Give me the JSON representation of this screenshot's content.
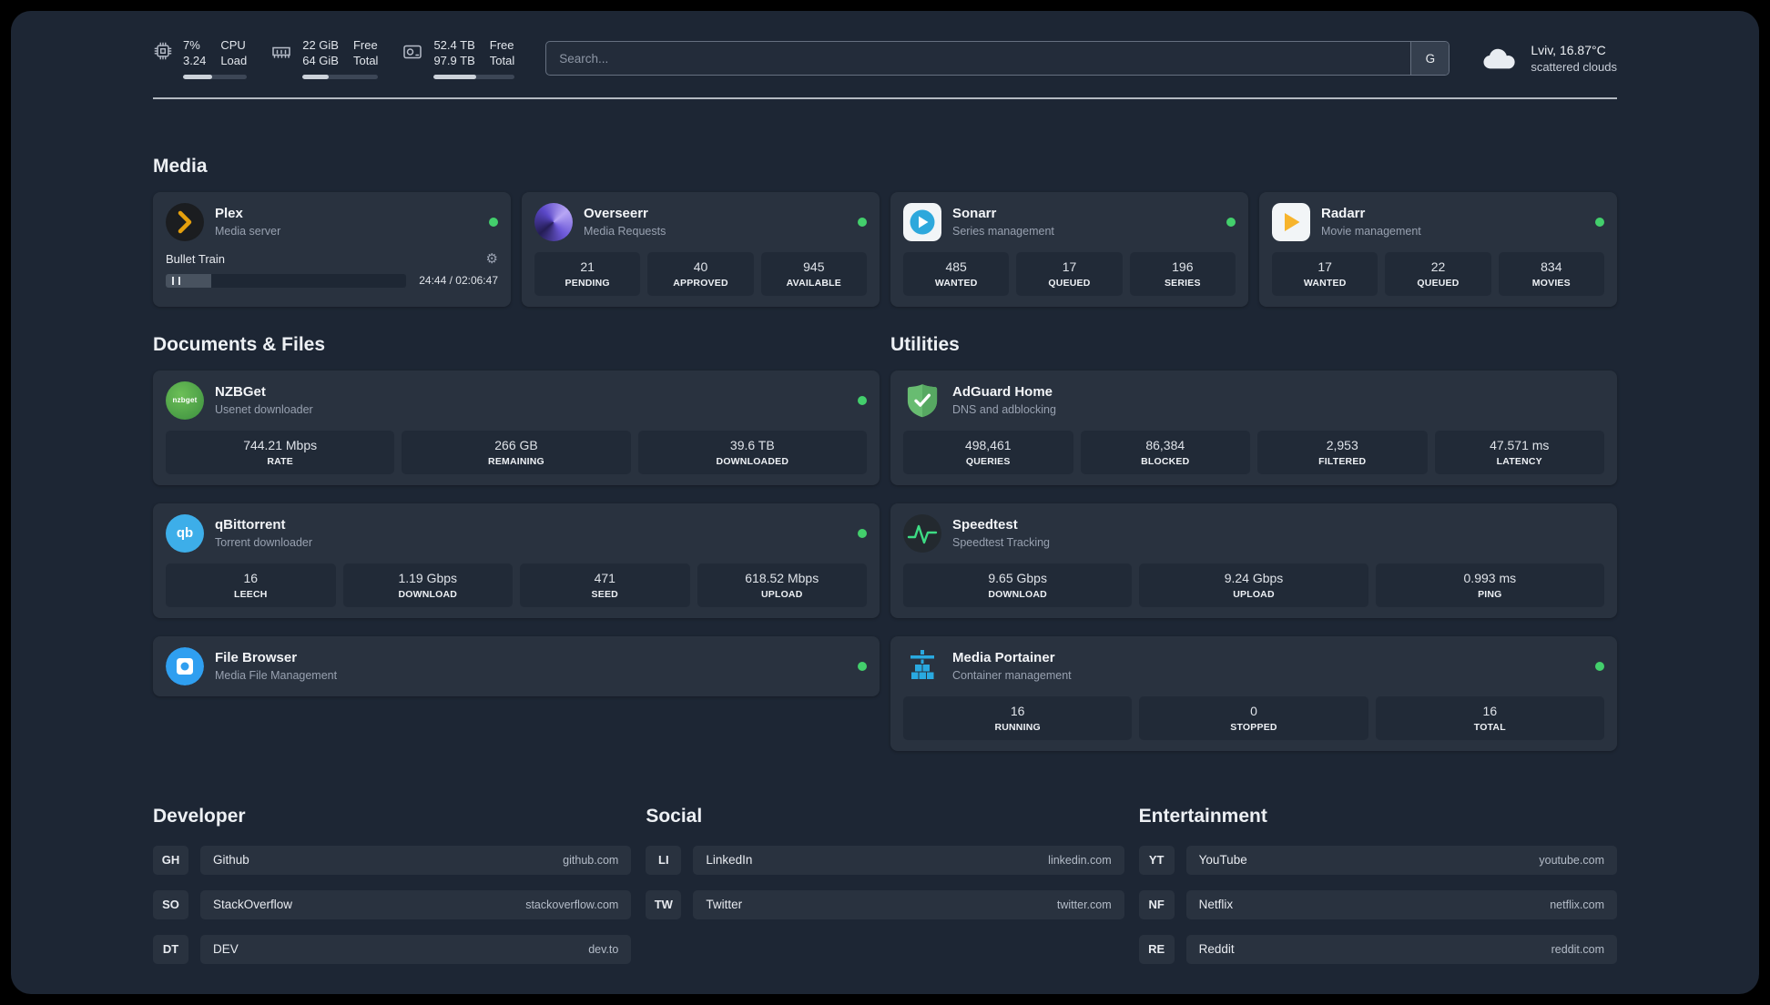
{
  "colors": {
    "background": "#1d2634",
    "card": "#29323f",
    "tile": "#212a37",
    "status_online": "#43cf6c",
    "plex_amber": "#e5a00d",
    "adguard_green": "#68bc71",
    "portainer_blue": "#29a9e0"
  },
  "topbar": {
    "cpu": {
      "icon": "cpu-icon",
      "percent": "7%",
      "load": "3.24",
      "label_top": "CPU",
      "label_bottom": "Load",
      "bar_percent": 45
    },
    "memory": {
      "icon": "memory-icon",
      "free": "22 GiB",
      "total": "64 GiB",
      "label_top": "Free",
      "label_bottom": "Total",
      "bar_percent": 34
    },
    "storage": {
      "icon": "hard-drive-icon",
      "free": "52.4 TB",
      "total": "97.9 TB",
      "label_top": "Free",
      "label_bottom": "Total",
      "bar_percent": 53
    },
    "search": {
      "placeholder": "Search...",
      "engine_label": "G"
    },
    "weather": {
      "icon": "cloud-icon",
      "location": "Lviv, 16.87°C",
      "condition": "scattered clouds"
    }
  },
  "sections": {
    "media": {
      "title": "Media",
      "plex": {
        "name": "Plex",
        "subtitle": "Media server",
        "status": "online",
        "now_playing": "Bullet Train",
        "time": "24:44 / 02:06:47",
        "progress_percent": 19
      },
      "overseerr": {
        "name": "Overseerr",
        "subtitle": "Media Requests",
        "status": "online",
        "stats": [
          {
            "value": "21",
            "label": "PENDING"
          },
          {
            "value": "40",
            "label": "APPROVED"
          },
          {
            "value": "945",
            "label": "AVAILABLE"
          }
        ]
      },
      "sonarr": {
        "name": "Sonarr",
        "subtitle": "Series management",
        "status": "online",
        "stats": [
          {
            "value": "485",
            "label": "WANTED"
          },
          {
            "value": "17",
            "label": "QUEUED"
          },
          {
            "value": "196",
            "label": "SERIES"
          }
        ]
      },
      "radarr": {
        "name": "Radarr",
        "subtitle": "Movie management",
        "status": "online",
        "stats": [
          {
            "value": "17",
            "label": "WANTED"
          },
          {
            "value": "22",
            "label": "QUEUED"
          },
          {
            "value": "834",
            "label": "MOVIES"
          }
        ]
      }
    },
    "documents": {
      "title": "Documents & Files",
      "nzbget": {
        "name": "NZBGet",
        "subtitle": "Usenet downloader",
        "status": "online",
        "icon_text": "nzbget",
        "stats": [
          {
            "value": "744.21 Mbps",
            "label": "RATE"
          },
          {
            "value": "266 GB",
            "label": "REMAINING"
          },
          {
            "value": "39.6 TB",
            "label": "DOWNLOADED"
          }
        ]
      },
      "qbittorrent": {
        "name": "qBittorrent",
        "subtitle": "Torrent downloader",
        "status": "online",
        "icon_text": "qb",
        "stats": [
          {
            "value": "16",
            "label": "LEECH"
          },
          {
            "value": "1.19 Gbps",
            "label": "DOWNLOAD"
          },
          {
            "value": "471",
            "label": "SEED"
          },
          {
            "value": "618.52 Mbps",
            "label": "UPLOAD"
          }
        ]
      },
      "filebrowser": {
        "name": "File Browser",
        "subtitle": "Media File Management",
        "status": "online"
      }
    },
    "utilities": {
      "title": "Utilities",
      "adguard": {
        "name": "AdGuard Home",
        "subtitle": "DNS and adblocking",
        "stats": [
          {
            "value": "498,461",
            "label": "QUERIES"
          },
          {
            "value": "86,384",
            "label": "BLOCKED"
          },
          {
            "value": "2,953",
            "label": "FILTERED"
          },
          {
            "value": "47.571 ms",
            "label": "LATENCY"
          }
        ]
      },
      "speedtest": {
        "name": "Speedtest",
        "subtitle": "Speedtest Tracking",
        "stats": [
          {
            "value": "9.65 Gbps",
            "label": "DOWNLOAD"
          },
          {
            "value": "9.24 Gbps",
            "label": "UPLOAD"
          },
          {
            "value": "0.993 ms",
            "label": "PING"
          }
        ]
      },
      "portainer": {
        "name": "Media Portainer",
        "subtitle": "Container management",
        "status": "online",
        "stats": [
          {
            "value": "16",
            "label": "RUNNING"
          },
          {
            "value": "0",
            "label": "STOPPED"
          },
          {
            "value": "16",
            "label": "TOTAL"
          }
        ]
      }
    },
    "developer": {
      "title": "Developer",
      "links": [
        {
          "abbr": "GH",
          "name": "Github",
          "url": "github.com"
        },
        {
          "abbr": "SO",
          "name": "StackOverflow",
          "url": "stackoverflow.com"
        },
        {
          "abbr": "DT",
          "name": "DEV",
          "url": "dev.to"
        }
      ]
    },
    "social": {
      "title": "Social",
      "links": [
        {
          "abbr": "LI",
          "name": "LinkedIn",
          "url": "linkedin.com"
        },
        {
          "abbr": "TW",
          "name": "Twitter",
          "url": "twitter.com"
        }
      ]
    },
    "entertainment": {
      "title": "Entertainment",
      "links": [
        {
          "abbr": "YT",
          "name": "YouTube",
          "url": "youtube.com"
        },
        {
          "abbr": "NF",
          "name": "Netflix",
          "url": "netflix.com"
        },
        {
          "abbr": "RE",
          "name": "Reddit",
          "url": "reddit.com"
        }
      ]
    }
  }
}
